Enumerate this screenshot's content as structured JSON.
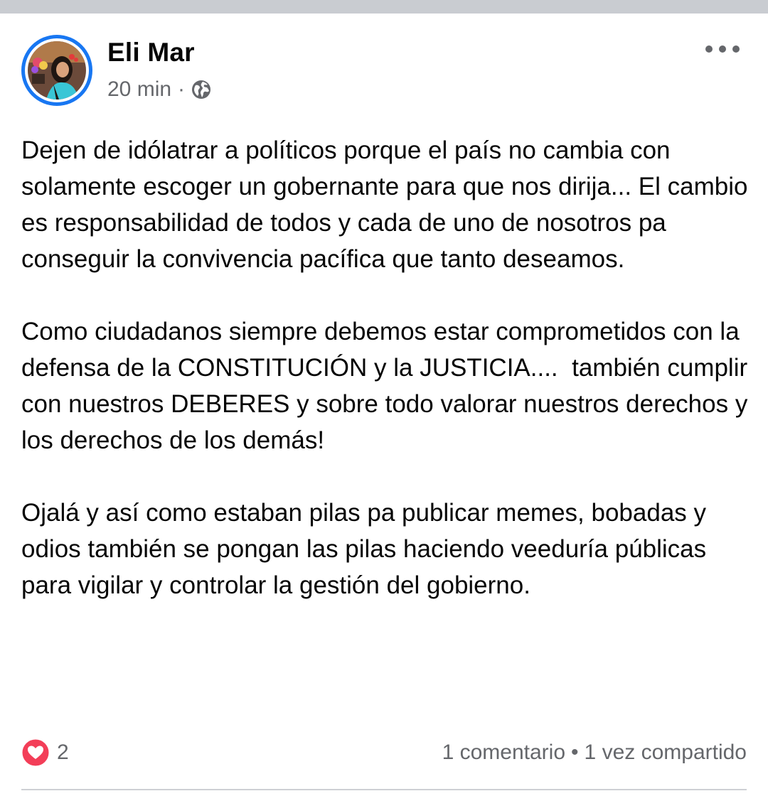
{
  "post": {
    "author": "Eli Mar",
    "time": "20 min",
    "separator": "·",
    "privacy_icon": "globe-icon",
    "more_icon": "more-horizontal-icon",
    "paragraphs": [
      "Dejen de idólatrar a políticos porque el país no cambia con solamente escoger un gobernante para que nos dirija... El cambio es responsabilidad de todos y cada de uno de nosotros pa conseguir la convivencia pacífica que tanto deseamos.",
      "Como ciudadanos siempre debemos estar comprometidos con la defensa de la CONSTITUCIÓN y la JUSTICIA....  también cumplir con nuestros DEBERES y sobre todo valorar nuestros derechos y los derechos de los demás!",
      "Ojalá y así como estaban pilas pa publicar memes, bobadas y odios también se pongan las pilas haciendo veeduría públicas para vigilar y controlar la gestión del gobierno."
    ]
  },
  "engagement": {
    "reaction_icon": "love-reaction-icon",
    "reaction_count": "2",
    "comments": "1 comentario",
    "stats_separator": "•",
    "shares": "1 vez compartido"
  },
  "colors": {
    "accent": "#1877f2",
    "love": "#f33e58",
    "secondary_text": "#65676b",
    "strip": "#c9ccd1"
  }
}
